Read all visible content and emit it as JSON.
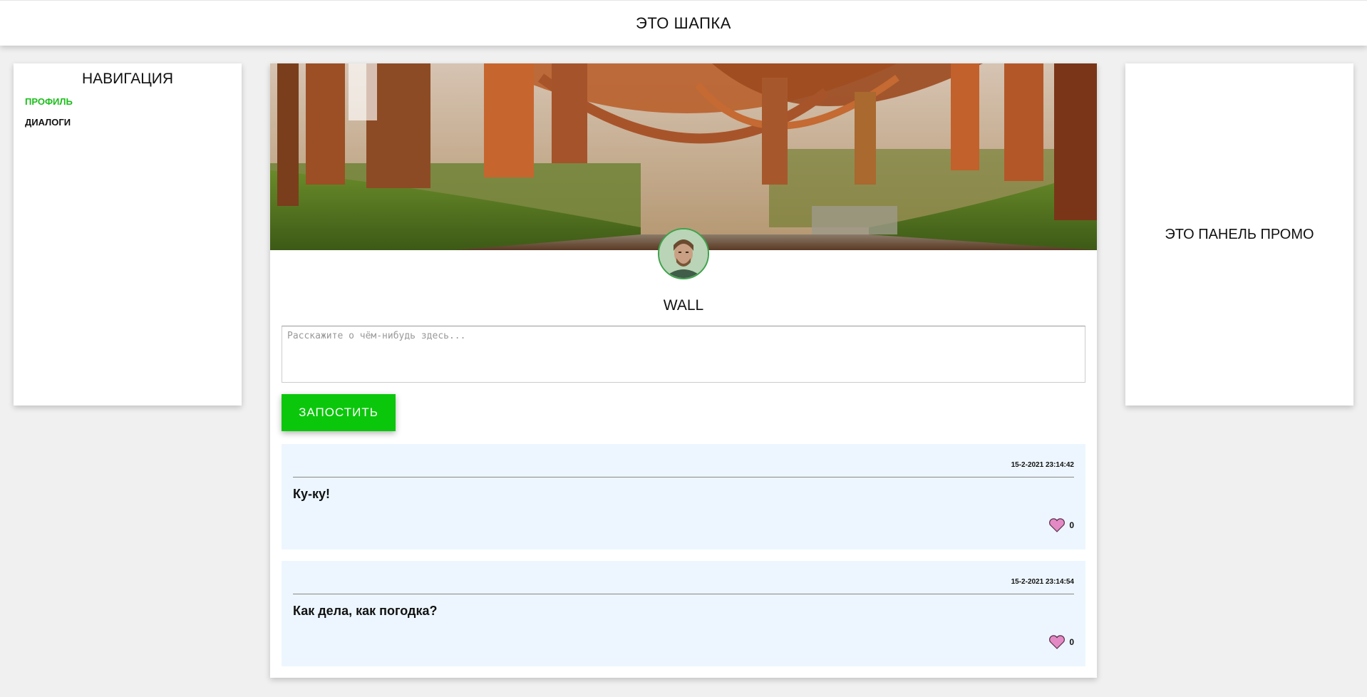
{
  "header": {
    "title": "ЭТО ШАПКА"
  },
  "nav": {
    "title": "НАВИГАЦИЯ",
    "items": [
      {
        "label": "ПРОФИЛЬ",
        "active": true
      },
      {
        "label": "ДИАЛОГИ",
        "active": false
      }
    ]
  },
  "promo": {
    "title": "ЭТО ПАНЕЛЬ ПРОМО"
  },
  "profile": {
    "cover_icon": "forest-road-image",
    "avatar_icon": "user-avatar"
  },
  "wall": {
    "title": "WALL",
    "input_placeholder": "Расскажите о чём-нибудь здесь...",
    "post_button_label": "ЗАПОСТИТЬ",
    "posts": [
      {
        "date": "15-2-2021 23:14:42",
        "text": "Ку-ку!",
        "likes": "0"
      },
      {
        "date": "15-2-2021 23:14:54",
        "text": "Как дела, как погодка?",
        "likes": "0"
      }
    ]
  },
  "colors": {
    "accent_green": "#0bc70b",
    "active_link": "#1bbf1b",
    "post_bg": "#edf6fe",
    "heart": "#e38ac5"
  }
}
